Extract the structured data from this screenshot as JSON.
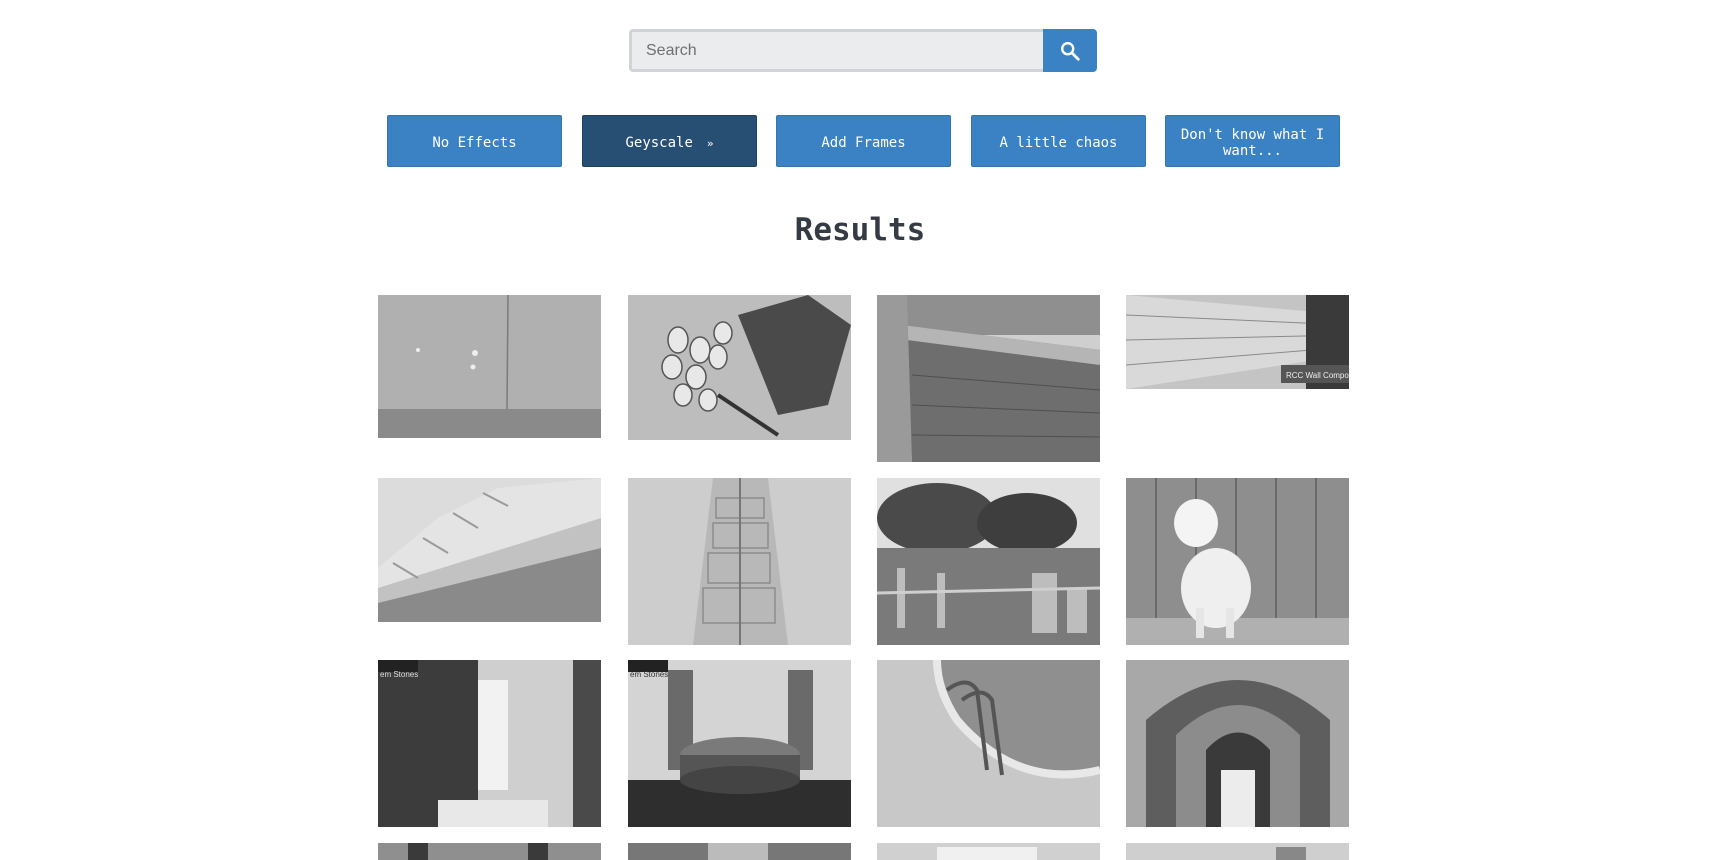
{
  "search": {
    "placeholder": "Search",
    "value": "",
    "button_icon": "search-icon"
  },
  "filters": [
    {
      "label": "No Effects",
      "active": false
    },
    {
      "label": "Geyscale",
      "active": true,
      "chevron": "»"
    },
    {
      "label": "Add Frames",
      "active": false
    },
    {
      "label": "A little chaos",
      "active": false
    },
    {
      "label": "Don't know what I want...",
      "active": false
    }
  ],
  "results": {
    "title": "Results",
    "images": [
      {
        "subject": "concrete-wall-with-flowers"
      },
      {
        "subject": "tulip-bouquet-with-shadow"
      },
      {
        "subject": "stone-retaining-wall"
      },
      {
        "subject": "precast-concrete-fence",
        "watermark": "RCC Wall Compo"
      },
      {
        "subject": "concrete-steps"
      },
      {
        "subject": "concrete-drainage-channel"
      },
      {
        "subject": "construction-site-with-trees"
      },
      {
        "subject": "white-calf-by-fence"
      },
      {
        "subject": "marble-bathroom",
        "watermark": "em Stones"
      },
      {
        "subject": "round-bed-bedroom",
        "watermark": "em Stones"
      },
      {
        "subject": "swimming-pool-ladder"
      },
      {
        "subject": "arched-corridor"
      },
      {
        "subject": "person-shoes-on-pavement"
      },
      {
        "subject": "brick-fireplace"
      },
      {
        "subject": "white-fence-gate"
      },
      {
        "subject": "chandelier-ceiling"
      }
    ]
  },
  "colors": {
    "primary": "#3b82c4",
    "active": "#264f73",
    "title": "#353b44"
  }
}
